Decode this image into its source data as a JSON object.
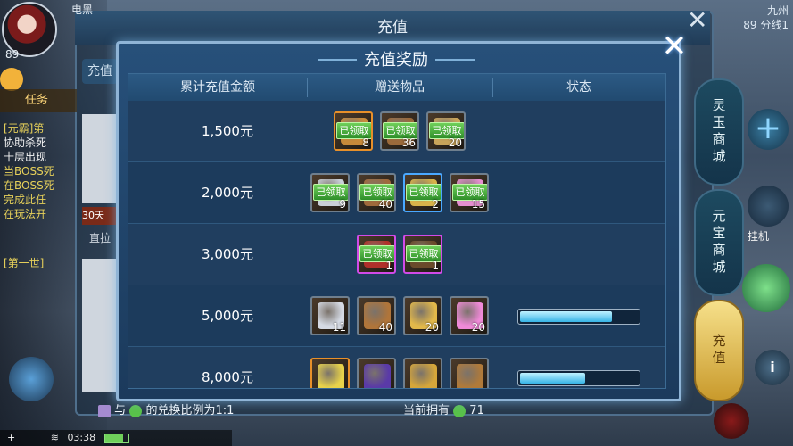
{
  "background": {
    "top_left_label": "电黑",
    "level": "89",
    "task_tab": "任务",
    "task_lines": [
      "[元霸]第一",
      "协助杀死",
      "十层出现",
      "当BOSS死",
      "在BOSS死",
      "完成此任",
      "在玩法开"
    ],
    "outer_title": "充值",
    "left_tab": "充值",
    "left_badge": "30天",
    "left_side_text": "直拉",
    "top_right": {
      "location": "九州",
      "line": "89 分线1"
    },
    "side_buttons": [
      "灵玉商城",
      "元宝商城",
      "充值"
    ],
    "hang_label": "挂机",
    "exchange_text": "与",
    "exchange_rate_text": "的兑换比例为1:1",
    "owned_label": "当前拥有",
    "owned_value": "71",
    "clock": "03:38",
    "first_task_label": "[第一世]"
  },
  "dialog": {
    "title": "充值奖励",
    "close": "✕",
    "headers": [
      "累计充值金额",
      "赠送物品",
      "状态"
    ],
    "rows": [
      {
        "amount": "1,500元",
        "items": [
          {
            "qty": "8",
            "claimed": true,
            "frame": "orange",
            "art": "#c88a3a"
          },
          {
            "qty": "36",
            "claimed": true,
            "frame": "gray",
            "art": "#9b6a3b"
          },
          {
            "qty": "20",
            "claimed": true,
            "frame": "gray",
            "art": "#c9a45a"
          }
        ],
        "progress": null
      },
      {
        "amount": "2,000元",
        "items": [
          {
            "qty": "9",
            "claimed": true,
            "frame": "gray",
            "art": "#c9cfd8"
          },
          {
            "qty": "40",
            "claimed": true,
            "frame": "gray",
            "art": "#a06a3c"
          },
          {
            "qty": "2",
            "claimed": true,
            "frame": "blue",
            "art": "#d8b24a"
          },
          {
            "qty": "15",
            "claimed": true,
            "frame": "gray",
            "art": "#e58fd0"
          }
        ],
        "progress": null
      },
      {
        "amount": "3,000元",
        "items": [
          {
            "qty": "1",
            "claimed": true,
            "frame": "purple",
            "art": "#b0302a"
          },
          {
            "qty": "1",
            "claimed": true,
            "frame": "purple",
            "art": "#6a4a2a"
          }
        ],
        "progress": null
      },
      {
        "amount": "5,000元",
        "items": [
          {
            "qty": "11",
            "claimed": false,
            "frame": "gray",
            "art": "#d5dae4"
          },
          {
            "qty": "40",
            "claimed": false,
            "frame": "gray",
            "art": "#b0753a"
          },
          {
            "qty": "20",
            "claimed": false,
            "frame": "gray",
            "art": "#e2b84a"
          },
          {
            "qty": "20",
            "claimed": false,
            "frame": "gray",
            "art": "#f08ad8"
          }
        ],
        "progress": 0.78
      },
      {
        "amount": "8,000元",
        "items": [
          {
            "qty": "",
            "claimed": false,
            "frame": "orange",
            "art": "#e8d24a"
          },
          {
            "qty": "",
            "claimed": false,
            "frame": "gray",
            "art": "#5a3aa8"
          },
          {
            "qty": "",
            "claimed": false,
            "frame": "gray",
            "art": "#d6a63a"
          },
          {
            "qty": "",
            "claimed": false,
            "frame": "gray",
            "art": "#b07a3a"
          }
        ],
        "progress": 0.55
      }
    ],
    "claimed_label": "已领取"
  },
  "colors": {
    "frame_orange": "#e8902a",
    "frame_blue": "#4aa8ff",
    "frame_purple": "#d24ae8",
    "frame_gray": "#6f7f8e"
  }
}
